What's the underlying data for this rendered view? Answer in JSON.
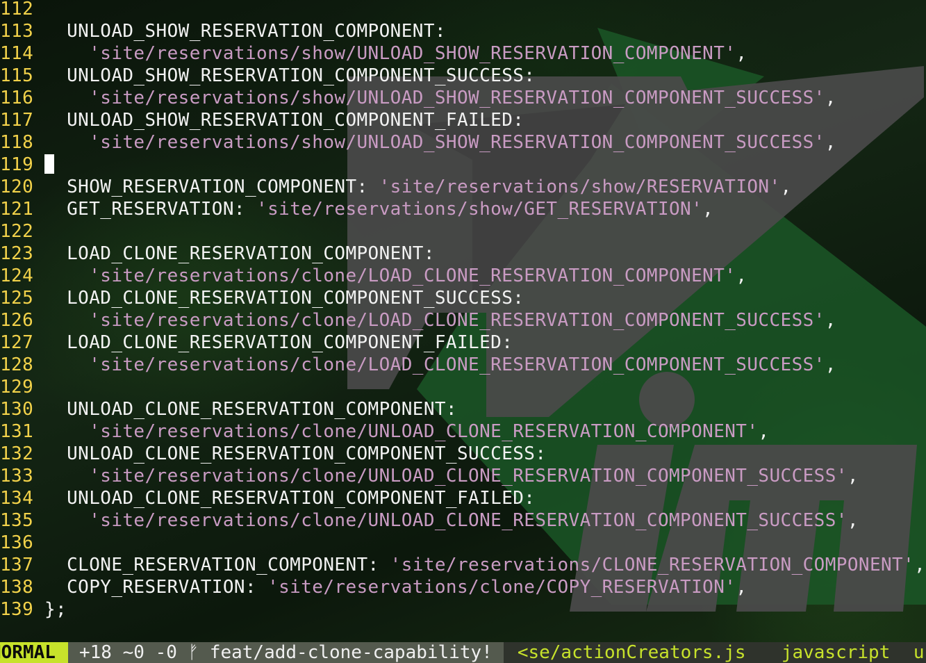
{
  "editor": {
    "lines": [
      {
        "num": "112",
        "indent": "",
        "code": "",
        "str": "",
        "tail": ""
      },
      {
        "num": "113",
        "indent": "  ",
        "code": "UNLOAD_SHOW_RESERVATION_COMPONENT:",
        "str": "",
        "tail": ""
      },
      {
        "num": "114",
        "indent": "    ",
        "code": "",
        "str": "'site/reservations/show/UNLOAD_SHOW_RESERVATION_COMPONENT'",
        "tail": ","
      },
      {
        "num": "115",
        "indent": "  ",
        "code": "UNLOAD_SHOW_RESERVATION_COMPONENT_SUCCESS:",
        "str": "",
        "tail": ""
      },
      {
        "num": "116",
        "indent": "    ",
        "code": "",
        "str": "'site/reservations/show/UNLOAD_SHOW_RESERVATION_COMPONENT_SUCCESS'",
        "tail": ","
      },
      {
        "num": "117",
        "indent": "  ",
        "code": "UNLOAD_SHOW_RESERVATION_COMPONENT_FAILED:",
        "str": "",
        "tail": ""
      },
      {
        "num": "118",
        "indent": "    ",
        "code": "",
        "str": "'site/reservations/show/UNLOAD_SHOW_RESERVATION_COMPONENT_SUCCESS'",
        "tail": ","
      },
      {
        "num": "119",
        "indent": "",
        "code": "",
        "str": "",
        "tail": "",
        "cursor": true
      },
      {
        "num": "120",
        "indent": "  ",
        "code": "SHOW_RESERVATION_COMPONENT: ",
        "str": "'site/reservations/show/RESERVATION'",
        "tail": ","
      },
      {
        "num": "121",
        "indent": "  ",
        "code": "GET_RESERVATION: ",
        "str": "'site/reservations/show/GET_RESERVATION'",
        "tail": ","
      },
      {
        "num": "122",
        "indent": "",
        "code": "",
        "str": "",
        "tail": ""
      },
      {
        "num": "123",
        "indent": "  ",
        "code": "LOAD_CLONE_RESERVATION_COMPONENT:",
        "str": "",
        "tail": ""
      },
      {
        "num": "124",
        "indent": "    ",
        "code": "",
        "str": "'site/reservations/clone/LOAD_CLONE_RESERVATION_COMPONENT'",
        "tail": ","
      },
      {
        "num": "125",
        "indent": "  ",
        "code": "LOAD_CLONE_RESERVATION_COMPONENT_SUCCESS:",
        "str": "",
        "tail": ""
      },
      {
        "num": "126",
        "indent": "    ",
        "code": "",
        "str": "'site/reservations/clone/LOAD_CLONE_RESERVATION_COMPONENT_SUCCESS'",
        "tail": ","
      },
      {
        "num": "127",
        "indent": "  ",
        "code": "LOAD_CLONE_RESERVATION_COMPONENT_FAILED:",
        "str": "",
        "tail": ""
      },
      {
        "num": "128",
        "indent": "    ",
        "code": "",
        "str": "'site/reservations/clone/LOAD_CLONE_RESERVATION_COMPONENT_SUCCESS'",
        "tail": ","
      },
      {
        "num": "129",
        "indent": "",
        "code": "",
        "str": "",
        "tail": ""
      },
      {
        "num": "130",
        "indent": "  ",
        "code": "UNLOAD_CLONE_RESERVATION_COMPONENT:",
        "str": "",
        "tail": ""
      },
      {
        "num": "131",
        "indent": "    ",
        "code": "",
        "str": "'site/reservations/clone/UNLOAD_CLONE_RESERVATION_COMPONENT'",
        "tail": ","
      },
      {
        "num": "132",
        "indent": "  ",
        "code": "UNLOAD_CLONE_RESERVATION_COMPONENT_SUCCESS:",
        "str": "",
        "tail": ""
      },
      {
        "num": "133",
        "indent": "    ",
        "code": "",
        "str": "'site/reservations/clone/UNLOAD_CLONE_RESERVATION_COMPONENT_SUCCESS'",
        "tail": ","
      },
      {
        "num": "134",
        "indent": "  ",
        "code": "UNLOAD_CLONE_RESERVATION_COMPONENT_FAILED:",
        "str": "",
        "tail": ""
      },
      {
        "num": "135",
        "indent": "    ",
        "code": "",
        "str": "'site/reservations/clone/UNLOAD_CLONE_RESERVATION_COMPONENT_SUCCESS'",
        "tail": ","
      },
      {
        "num": "136",
        "indent": "",
        "code": "",
        "str": "",
        "tail": ""
      },
      {
        "num": "137",
        "indent": "  ",
        "code": "CLONE_RESERVATION_COMPONENT: ",
        "str": "'site/reservations/CLONE_RESERVATION_COMPONENT'",
        "tail": ","
      },
      {
        "num": "138",
        "indent": "  ",
        "code": "COPY_RESERVATION: ",
        "str": "'site/reservations/clone/COPY_RESERVATION'",
        "tail": ","
      },
      {
        "num": "139",
        "indent": "",
        "code": "};",
        "str": "",
        "tail": ""
      }
    ]
  },
  "statusbar": {
    "mode": "NORMAL",
    "git_diff": "+18 ~0 -0",
    "branch_icon": "branch-icon",
    "branch": "feat/add-clone-capability!",
    "file": "<se/actionCreators.js",
    "filetype": "javascript",
    "position": "u"
  },
  "colors": {
    "line_number": "#f2d24a",
    "string": "#c99bc3",
    "text": "#f2f2f2",
    "mode_bg": "#c7e22b",
    "statusbar_bg": "#2f332c"
  },
  "background_logo": "vim-logo"
}
